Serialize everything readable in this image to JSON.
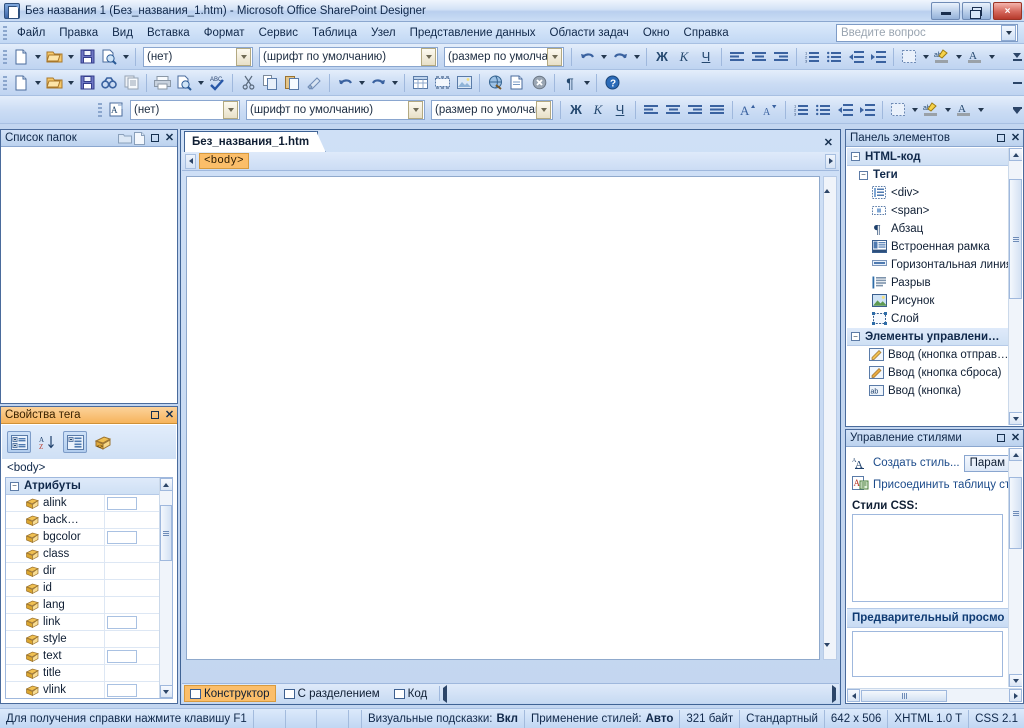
{
  "window": {
    "title": "Без названия 1 (Без_названия_1.htm) - Microsoft Office SharePoint Designer",
    "app_icon": "sharepoint-designer-icon",
    "minimize_label": "minimize",
    "restore_label": "restore",
    "close_label": "×"
  },
  "menu": {
    "items": [
      {
        "label": "Файл"
      },
      {
        "label": "Правка"
      },
      {
        "label": "Вид"
      },
      {
        "label": "Вставка"
      },
      {
        "label": "Формат"
      },
      {
        "label": "Сервис"
      },
      {
        "label": "Таблица"
      },
      {
        "label": "Узел"
      },
      {
        "label": "Представление данных"
      },
      {
        "label": "Области задач"
      },
      {
        "label": "Окно"
      },
      {
        "label": "Справка"
      }
    ],
    "ask_placeholder": "Введите вопрос"
  },
  "toolbar_style": {
    "style_combo": "(нет)",
    "font_combo": "(шрифт по умолчанию)",
    "size_combo": "(размер по умолчан",
    "buttons": [
      {
        "name": "new-page-button",
        "icon": "new-document-icon"
      },
      {
        "name": "open-button",
        "icon": "open-folder-icon"
      },
      {
        "name": "save-button",
        "icon": "floppy-save-icon"
      },
      {
        "name": "preview-browser-button",
        "icon": "page-magnifier-icon"
      }
    ]
  },
  "toolbar_standard": {
    "buttons": [
      {
        "name": "new-button",
        "icon": "new-document-icon"
      },
      {
        "name": "open-button",
        "icon": "open-folder-icon"
      },
      {
        "name": "save-button",
        "icon": "floppy-save-icon"
      },
      {
        "name": "find-button",
        "icon": "binoculars-icon"
      },
      {
        "name": "publish-site-button",
        "icon": "publish-pages-icon"
      },
      {
        "name": "print-button",
        "icon": "printer-icon"
      },
      {
        "name": "preview-button",
        "icon": "page-magnifier-icon"
      },
      {
        "name": "spelling-button",
        "icon": "abc-check-icon"
      },
      {
        "name": "cut-button",
        "icon": "scissors-icon"
      },
      {
        "name": "copy-button",
        "icon": "copy-icon"
      },
      {
        "name": "paste-button",
        "icon": "paste-icon"
      },
      {
        "name": "format-painter-button",
        "icon": "paintbrush-icon"
      },
      {
        "name": "undo-button",
        "icon": "undo-arrow-icon"
      },
      {
        "name": "redo-button",
        "icon": "redo-arrow-icon"
      },
      {
        "name": "insert-table-button",
        "icon": "table-grid-icon"
      },
      {
        "name": "insert-layout-table-button",
        "icon": "layout-table-icon"
      },
      {
        "name": "insert-picture-button",
        "icon": "picture-icon"
      },
      {
        "name": "insert-hyperlink-button",
        "icon": "globe-link-icon"
      },
      {
        "name": "new-aspx-button",
        "icon": "page-blue-icon"
      },
      {
        "name": "web-part-button",
        "icon": "circle-x-icon"
      },
      {
        "name": "show-marks-button",
        "icon": "pilcrow-icon"
      },
      {
        "name": "help-button",
        "icon": "question-help-icon"
      }
    ]
  },
  "toolbar_format": {
    "style_combo": "(нет)",
    "font_combo": "(шрифт по умолчанию)",
    "size_combo": "(размер по умолчан",
    "buttons": [
      {
        "name": "style-button",
        "icon": "style-page-icon"
      },
      {
        "name": "bold-button",
        "icon": "bold-icon",
        "glyph": "Ж"
      },
      {
        "name": "italic-button",
        "icon": "italic-icon",
        "glyph": "К"
      },
      {
        "name": "underline-button",
        "icon": "underline-icon",
        "glyph": "Ч"
      },
      {
        "name": "align-left-button",
        "icon": "align-left-icon"
      },
      {
        "name": "align-center-button",
        "icon": "align-center-icon"
      },
      {
        "name": "align-right-button",
        "icon": "align-right-icon"
      },
      {
        "name": "align-justify-button",
        "icon": "align-justify-icon"
      },
      {
        "name": "grow-font-button",
        "icon": "font-grow-icon"
      },
      {
        "name": "shrink-font-button",
        "icon": "font-shrink-icon"
      },
      {
        "name": "numbered-list-button",
        "icon": "numbered-list-icon"
      },
      {
        "name": "bulleted-list-button",
        "icon": "bulleted-list-icon"
      },
      {
        "name": "decrease-indent-button",
        "icon": "decrease-indent-icon"
      },
      {
        "name": "increase-indent-button",
        "icon": "increase-indent-icon"
      },
      {
        "name": "borders-button",
        "icon": "borders-icon"
      },
      {
        "name": "highlight-button",
        "icon": "highlight-abc-icon"
      },
      {
        "name": "font-color-button",
        "icon": "font-color-a-icon"
      }
    ]
  },
  "folder_list": {
    "title": "Список папок",
    "icons": [
      {
        "name": "new-folder-icon"
      },
      {
        "name": "new-page-icon"
      },
      {
        "name": "maximize-icon"
      },
      {
        "name": "close-icon",
        "glyph": "✕"
      }
    ]
  },
  "tag_properties": {
    "title": "Свойства тега",
    "maximize_glyph": "□",
    "close_glyph": "✕",
    "tools": [
      {
        "name": "categorized-view-button",
        "icon": "categorized-icon",
        "pressed": true
      },
      {
        "name": "alphabetical-sort-button",
        "icon": "az-sort-icon",
        "pressed": false
      },
      {
        "name": "grouped-view-button",
        "icon": "grouped-list-icon",
        "pressed": true
      },
      {
        "name": "edit-tag-button",
        "icon": "edit-tag-icon",
        "pressed": false
      }
    ],
    "selected_tag": "<body>",
    "group_label": "Атрибуты",
    "group_expander": "−",
    "attributes": [
      {
        "name": "alink",
        "has_value_box": true
      },
      {
        "name": "back…",
        "has_value_box": false
      },
      {
        "name": "bgcolor",
        "has_value_box": true
      },
      {
        "name": "class",
        "has_value_box": false
      },
      {
        "name": "dir",
        "has_value_box": false
      },
      {
        "name": "id",
        "has_value_box": false
      },
      {
        "name": "lang",
        "has_value_box": false
      },
      {
        "name": "link",
        "has_value_box": true
      },
      {
        "name": "style",
        "has_value_box": false
      },
      {
        "name": "text",
        "has_value_box": true
      },
      {
        "name": "title",
        "has_value_box": false
      },
      {
        "name": "vlink",
        "has_value_box": true
      }
    ]
  },
  "editor": {
    "tab_label": "Без_названия_1.htm",
    "tab_close_glyph": "✕",
    "quick_tag": "<body>",
    "view_tabs": [
      {
        "label": "Конструктор",
        "active": true,
        "icon": "design-view-icon"
      },
      {
        "label": "С разделением",
        "active": false,
        "icon": "split-view-icon"
      },
      {
        "label": "Код",
        "active": false,
        "icon": "code-view-icon"
      }
    ]
  },
  "toolbox": {
    "title": "Панель элементов",
    "maximize_glyph": "□",
    "close_glyph": "✕",
    "sections": [
      {
        "label": "HTML-код",
        "expander": "−",
        "type": "group",
        "subsections": [
          {
            "label": "Теги",
            "expander": "−",
            "items": [
              {
                "label": "<div>",
                "icon": "div-tag-icon"
              },
              {
                "label": "<span>",
                "icon": "span-tag-icon"
              },
              {
                "label": "Абзац",
                "icon": "paragraph-pilcrow-icon"
              },
              {
                "label": "Встроенная рамка",
                "icon": "inline-frame-icon"
              },
              {
                "label": "Горизонтальная линия",
                "icon": "horizontal-rule-icon"
              },
              {
                "label": "Разрыв",
                "icon": "line-break-icon"
              },
              {
                "label": "Рисунок",
                "icon": "image-icon"
              },
              {
                "label": "Слой",
                "icon": "layer-icon"
              }
            ]
          }
        ]
      },
      {
        "label": "Элементы управлени…",
        "expander": "−",
        "type": "group",
        "items": [
          {
            "label": "Ввод (кнопка отправ…",
            "icon": "input-submit-icon"
          },
          {
            "label": "Ввод (кнопка сброса)",
            "icon": "input-reset-icon"
          },
          {
            "label": "Ввод (кнопка)",
            "icon": "input-button-icon"
          }
        ]
      }
    ]
  },
  "styles_panel": {
    "title": "Управление стилями",
    "maximize_glyph": "□",
    "close_glyph": "✕",
    "new_style_label": "Создать стиль...",
    "new_style_icon": "new-style-a-icon",
    "options_button": "Парам",
    "attach_label": "Присоединить таблицу ст",
    "attach_icon": "attach-stylesheet-icon",
    "css_styles_label": "Стили CSS:",
    "preview_label": "Предварительный просмо"
  },
  "status_bar": {
    "help_hint": "Для получения справки нажмите клавишу F1",
    "visual_aids_label": "Визуальные подсказки:",
    "visual_aids_value": "Вкл",
    "style_application_label": "Применение стилей:",
    "style_application_value": "Авто",
    "size": "321 байт",
    "standard": "Стандартный",
    "dimensions": "642 x 506",
    "doctype": "XHTML 1.0 T",
    "css_version": "CSS 2.1"
  },
  "colors": {
    "accent_orange": "#fbbe6a",
    "panel_header_blue": "#cfe0f5",
    "workspace_blue": "#c3d6f0",
    "border_blue": "#4a6b9c",
    "close_red": "#b63a2c"
  }
}
